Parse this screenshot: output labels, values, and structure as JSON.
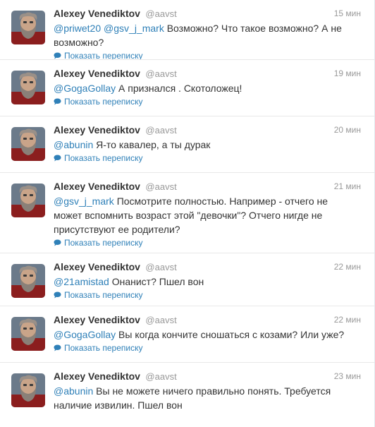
{
  "colors": {
    "link": "#2f80b8",
    "meta": "#999999",
    "text": "#333333",
    "divider": "#e8e8e8"
  },
  "icons": {
    "avatar": "bearded-man-photo",
    "expand": "speech-bubble-icon"
  },
  "tweets": [
    {
      "fullname": "Alexey Venediktov",
      "username": "@aavst",
      "time": "15 мин",
      "mentions": [
        "@priwet20",
        "@gsv_j_mark"
      ],
      "text": "Возможно? Что такое возможно? А не возможно?",
      "expand_label": "Показать переписку"
    },
    {
      "fullname": "Alexey Venediktov",
      "username": "@aavst",
      "time": "19 мин",
      "mentions": [
        "@GogaGollay"
      ],
      "text": "А признался . Скотоложец!",
      "expand_label": "Показать переписку"
    },
    {
      "fullname": "Alexey Venediktov",
      "username": "@aavst",
      "time": "20 мин",
      "mentions": [
        "@abunin"
      ],
      "text": "Я-то кавалер, а ты дурак",
      "expand_label": "Показать переписку"
    },
    {
      "fullname": "Alexey Venediktov",
      "username": "@aavst",
      "time": "21 мин",
      "mentions": [
        "@gsv_j_mark"
      ],
      "text": "Посмотрите полностью. Например - отчего не может вспомнить возраст этой \"девочки\"? Отчего нигде не присутствуют ее родители?",
      "expand_label": "Показать переписку"
    },
    {
      "fullname": "Alexey Venediktov",
      "username": "@aavst",
      "time": "22 мин",
      "mentions": [
        "@21amistad"
      ],
      "text": "Онанист? Пшел вон",
      "expand_label": "Показать переписку"
    },
    {
      "fullname": "Alexey Venediktov",
      "username": "@aavst",
      "time": "22 мин",
      "mentions": [
        "@GogaGollay"
      ],
      "text": "Вы когда кончите сношаться с козами? Или уже?",
      "expand_label": "Показать переписку"
    },
    {
      "fullname": "Alexey Venediktov",
      "username": "@aavst",
      "time": "23 мин",
      "mentions": [
        "@abunin"
      ],
      "text": "Вы не можете ничего правильно понять. Требуется наличие извилин. Пшел вон",
      "expand_label": ""
    }
  ]
}
